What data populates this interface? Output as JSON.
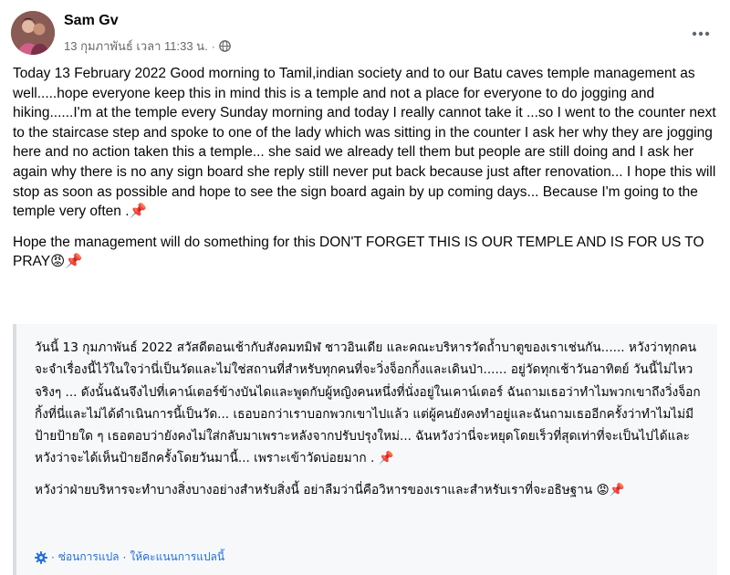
{
  "post": {
    "author": "Sam Gv",
    "timestamp": "13 กุมภาพันธ์ เวลา 11:33 น.",
    "separator": "·",
    "paragraphs": [
      "Today 13 February 2022 Good morning to Tamil,indian society and to our Batu caves temple management as well.....hope everyone keep this in mind this is a temple and not a place for everyone to do jogging and hiking......I'm at the temple every Sunday morning and today I really cannot take it ...so I went to the counter next to the staircase step and spoke to one of the lady which was sitting in the counter I ask her why they are jogging here and no action taken this a temple... she said we already tell them but people are still doing and I ask her again why there is no any sign board she reply still never put back because just after renovation... I hope this will stop as soon as possible and hope to see the sign board again by up coming days... Because I'm going to the temple very often .📌",
      "Hope the management will do something for this DON'T FORGET THIS IS OUR TEMPLE AND IS FOR US TO PRAY😡📌"
    ],
    "translation": {
      "paragraphs": [
        "วันนี้ 13 กุมภาพันธ์ 2022 สวัสดีตอนเช้ากับสังคมทมิฬ ชาวอินเดีย และคณะบริหารวัดถ้ำบาตูของเราเช่นกัน...... หวังว่าทุกคนจะจำเรื่องนี้ไว้ในใจว่านี่เป็นวัดและไม่ใช่สถานที่สำหรับทุกคนที่จะวิ่งจ็อกกิ้งและเดินป่า...... อยู่วัดทุกเช้าวันอาทิตย์ วันนี้ไม่ไหวจริงๆ ... ดังนั้นฉันจึงไปที่เคาน์เตอร์ข้างบันไดและพูดกับผู้หญิงคนหนึ่งที่นั่งอยู่ในเคาน์เตอร์ ฉันถามเธอว่าทำไมพวกเขาถึงวิ่งจ็อกกิ้งที่นี่และไม่ได้ดำเนินการนี้เป็นวัด... เธอบอกว่าเราบอกพวกเขาไปแล้ว แต่ผู้คนยังคงทำอยู่และฉันถามเธออีกครั้งว่าทำไมไม่มีป้ายป้ายใด ๆ เธอตอบว่ายังคงไม่ใส่กลับมาเพราะหลังจากปรับปรุงใหม่... ฉันหวังว่านี่จะหยุดโดยเร็วที่สุดเท่าที่จะเป็นไปได้และหวังว่าจะได้เห็นป้ายอีกครั้งโดยวันมานี้... เพราะเข้าวัดบ่อยมาก . 📌",
        "หวังว่าฝ่ายบริหารจะทำบางสิ่งบางอย่างสำหรับสิ่งนี้ อย่าลืมว่านี่คือวิหารของเราและสำหรับเราที่จะอธิษฐาน 😡📌"
      ],
      "hide_label": "ซ่อนการแปล",
      "rate_label": "ให้คะแนนการแปลนี้",
      "link_separator": "·"
    }
  },
  "colors": {
    "link": "#216fdb",
    "secondary_text": "#65676b",
    "quote_bg": "#f7f8fa",
    "quote_border": "#dadde1"
  },
  "icons": {
    "avatar": "profile-photo",
    "privacy": "globe-icon",
    "menu": "more-horizontal-icon",
    "translate": "gear-icon"
  }
}
